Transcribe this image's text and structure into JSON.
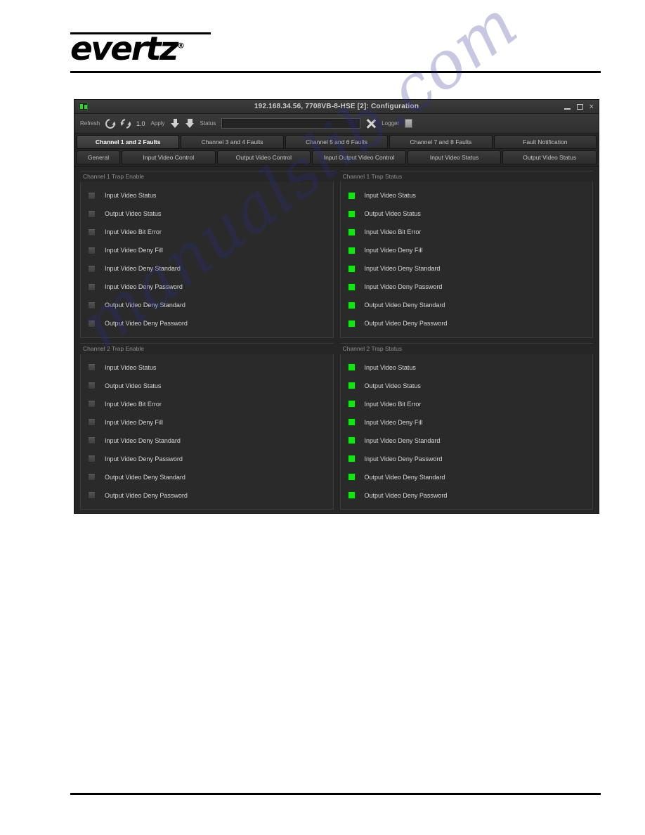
{
  "page": {
    "logo_text": "evertz",
    "logo_registered": "®",
    "watermark": "manualslib.com"
  },
  "window": {
    "title": "192.168.34.56, 7708VB-8-HSE  [2]: Configuration",
    "app_icon": "device-icon",
    "controls": {
      "minimize": "minimize-icon",
      "maximize": "maximize-icon",
      "close": "×"
    }
  },
  "toolbar": {
    "refresh_label": "Refresh",
    "refresh_icon": "refresh-icon",
    "refresh_all_icon": "refresh-all-icon",
    "version": "1.0",
    "apply_label": "Apply",
    "apply_icon": "apply-down-icon",
    "apply_all_icon": "apply-all-down-icon",
    "status_label": "Status",
    "status_value": "",
    "status_placeholder": "",
    "cancel_icon": "close-x-icon",
    "logger_label": "Logger",
    "logger_button": "logger-toggle-icon"
  },
  "tabs_row1": [
    {
      "label": "Channel 1 and 2 Faults",
      "active": true
    },
    {
      "label": "Channel 3 and 4 Faults",
      "active": false
    },
    {
      "label": "Channel 5 and 6 Faults",
      "active": false
    },
    {
      "label": "Channel 7 and 8 Faults",
      "active": false
    },
    {
      "label": "Fault Notification",
      "active": false
    }
  ],
  "tabs_row2": [
    {
      "label": "General",
      "active": false
    },
    {
      "label": "Input Video Control",
      "active": false
    },
    {
      "label": "Output Video Control",
      "active": false
    },
    {
      "label": "Input Output Video Control",
      "active": false
    },
    {
      "label": "Input Video Status",
      "active": false
    },
    {
      "label": "Output Video Status",
      "active": false
    }
  ],
  "groups": [
    {
      "title": "Channel 1 Trap Enable",
      "control": "checkbox",
      "rows": [
        {
          "label": "Input Video Status",
          "checked": false
        },
        {
          "label": "Output Video Status",
          "checked": false
        },
        {
          "label": "Input Video Bit Error",
          "checked": false
        },
        {
          "label": "Input Video Deny Fill",
          "checked": false
        },
        {
          "label": "Input Video Deny Standard",
          "checked": false
        },
        {
          "label": "Input Video Deny Password",
          "checked": false
        },
        {
          "label": "Output Video Deny Standard",
          "checked": false
        },
        {
          "label": "Output Video Deny Password",
          "checked": false
        }
      ]
    },
    {
      "title": "Channel 1 Trap Status",
      "control": "led",
      "led_color": "#12e612",
      "rows": [
        {
          "label": "Input Video Status",
          "state": "green"
        },
        {
          "label": "Output Video Status",
          "state": "green"
        },
        {
          "label": "Input Video Bit Error",
          "state": "green"
        },
        {
          "label": "Input Video Deny Fill",
          "state": "green"
        },
        {
          "label": "Input Video Deny Standard",
          "state": "green"
        },
        {
          "label": "Input Video Deny Password",
          "state": "green"
        },
        {
          "label": "Output Video Deny Standard",
          "state": "green"
        },
        {
          "label": "Output Video Deny Password",
          "state": "green"
        }
      ]
    },
    {
      "title": "Channel 2 Trap Enable",
      "control": "checkbox",
      "rows": [
        {
          "label": "Input Video Status",
          "checked": false
        },
        {
          "label": "Output Video Status",
          "checked": false
        },
        {
          "label": "Input Video Bit Error",
          "checked": false
        },
        {
          "label": "Input Video Deny Fill",
          "checked": false
        },
        {
          "label": "Input Video Deny Standard",
          "checked": false
        },
        {
          "label": "Input Video Deny Password",
          "checked": false
        },
        {
          "label": "Output Video Deny Standard",
          "checked": false
        },
        {
          "label": "Output Video Deny Password",
          "checked": false
        }
      ]
    },
    {
      "title": "Channel 2 Trap Status",
      "control": "led",
      "led_color": "#12e612",
      "rows": [
        {
          "label": "Input Video Status",
          "state": "green"
        },
        {
          "label": "Output Video Status",
          "state": "green"
        },
        {
          "label": "Input Video Bit Error",
          "state": "green"
        },
        {
          "label": "Input Video Deny Fill",
          "state": "green"
        },
        {
          "label": "Input Video Deny Standard",
          "state": "green"
        },
        {
          "label": "Input Video Deny Password",
          "state": "green"
        },
        {
          "label": "Output Video Deny Standard",
          "state": "green"
        },
        {
          "label": "Output Video Deny Password",
          "state": "green"
        }
      ]
    }
  ]
}
